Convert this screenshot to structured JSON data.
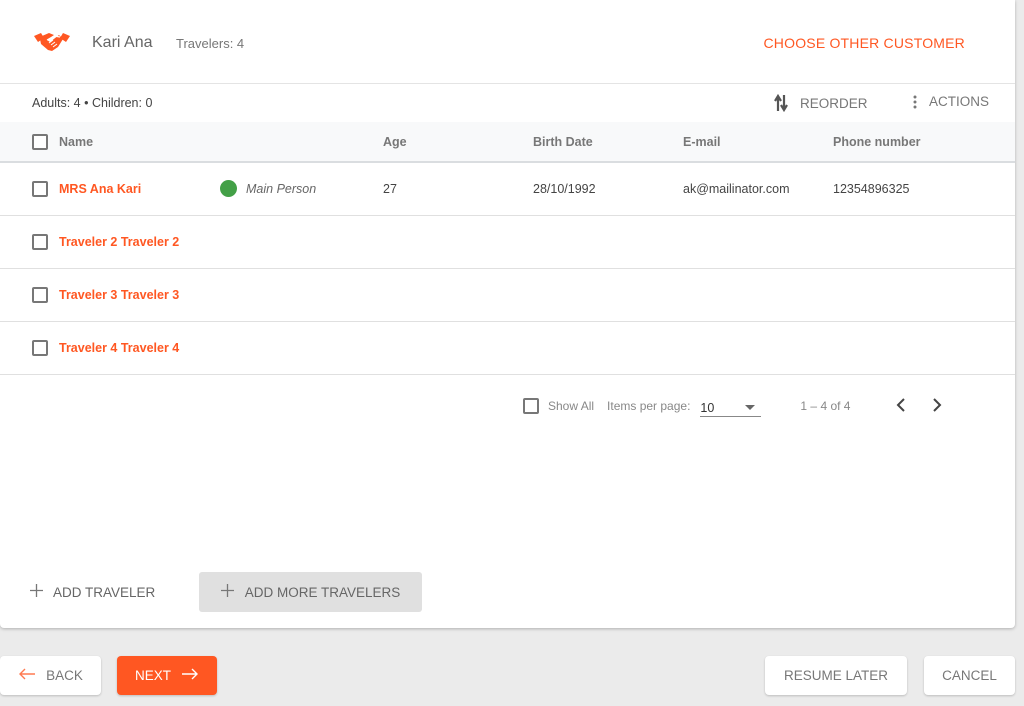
{
  "header": {
    "logo_icon": "handshake-icon",
    "customer_name": "Kari Ana",
    "travelers_count": "Travelers: 4",
    "choose_other_label": "CHOOSE OTHER CUSTOMER"
  },
  "subbar": {
    "summary": "Adults: 4 • Children: 0",
    "reorder_label": "REORDER",
    "reorder_icon": "swap-vertical-icon",
    "actions_label": "ACTIONS",
    "actions_icon": "more-vertical-icon"
  },
  "table": {
    "columns": [
      "Name",
      "Age",
      "Birth Date",
      "E-mail",
      "Phone number"
    ],
    "rows": [
      {
        "name": "MRS Ana Kari",
        "badge": "Main Person",
        "badge_color": "#43a047",
        "age": "27",
        "birth_date": "28/10/1992",
        "email": "ak@mailinator.com",
        "phone": "12354896325"
      },
      {
        "name": "Traveler 2 Traveler 2",
        "badge": "",
        "age": "",
        "birth_date": "",
        "email": "",
        "phone": ""
      },
      {
        "name": "Traveler 3 Traveler 3",
        "badge": "",
        "age": "",
        "birth_date": "",
        "email": "",
        "phone": ""
      },
      {
        "name": "Traveler 4 Traveler 4",
        "badge": "",
        "age": "",
        "birth_date": "",
        "email": "",
        "phone": ""
      }
    ]
  },
  "paginator": {
    "show_all_label": "Show All",
    "items_per_page_label": "Items per page:",
    "items_per_page_value": "10",
    "range_label": "1 – 4 of 4"
  },
  "actions": {
    "add_traveler_label": "ADD TRAVELER",
    "add_more_label": "ADD MORE TRAVELERS"
  },
  "footer": {
    "back_label": "BACK",
    "next_label": "NEXT",
    "resume_label": "RESUME LATER",
    "cancel_label": "CANCEL"
  },
  "colors": {
    "accent": "#ff5722",
    "main_person": "#43a047"
  }
}
